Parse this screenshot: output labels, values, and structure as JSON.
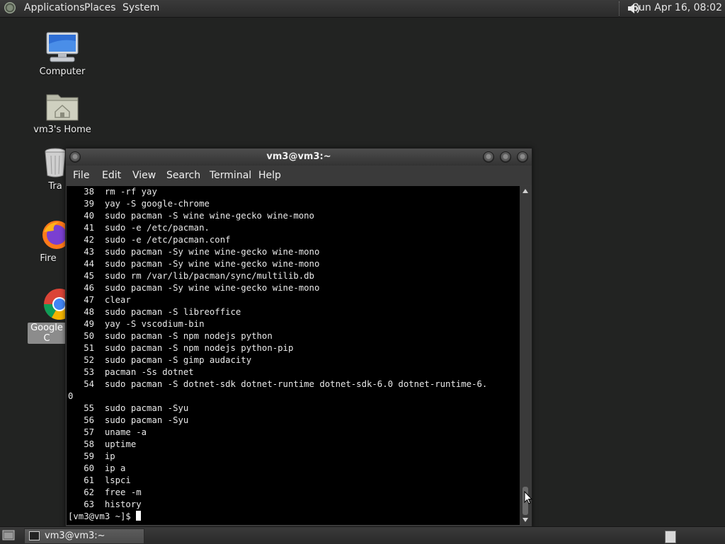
{
  "top_panel": {
    "menus": [
      "Applications",
      "Places",
      "System"
    ],
    "clock": "Sun Apr 16, 08:02",
    "icons": {
      "logo": "distro-logo-icon",
      "volume": "speaker-icon"
    }
  },
  "desktop": {
    "icons": [
      {
        "label": "Computer",
        "icon": "computer-icon"
      },
      {
        "label": "vm3's Home",
        "icon": "home-folder-icon"
      },
      {
        "label": "Tra",
        "icon": "trash-icon"
      },
      {
        "label": "Fire",
        "icon": "firefox-icon"
      },
      {
        "label": "Google C",
        "icon": "chrome-icon"
      }
    ]
  },
  "terminal": {
    "title": "vm3@vm3:~",
    "menu": [
      "File",
      "Edit",
      "View",
      "Search",
      "Terminal",
      "Help"
    ],
    "lines": [
      "   38  rm -rf yay",
      "   39  yay -S google-chrome",
      "   40  sudo pacman -S wine wine-gecko wine-mono",
      "   41  sudo -e /etc/pacman.",
      "   42  sudo -e /etc/pacman.conf",
      "   43  sudo pacman -Sy wine wine-gecko wine-mono",
      "   44  sudo pacman -Sy wine wine-gecko wine-mono",
      "   45  sudo rm /var/lib/pacman/sync/multilib.db",
      "   46  sudo pacman -Sy wine wine-gecko wine-mono",
      "   47  clear",
      "   48  sudo pacman -S libreoffice",
      "   49  yay -S vscodium-bin",
      "   50  sudo pacman -S npm nodejs python",
      "   51  sudo pacman -S npm nodejs python-pip",
      "   52  sudo pacman -S gimp audacity",
      "   53  pacman -Ss dotnet",
      "   54  sudo pacman -S dotnet-sdk dotnet-runtime dotnet-sdk-6.0 dotnet-runtime-6.",
      "0",
      "   55  sudo pacman -Syu",
      "   56  sudo pacman -Syu",
      "   57  uname -a",
      "   58  uptime",
      "   59  ip",
      "   60  ip a",
      "   61  lspci",
      "   62  free -m",
      "   63  history"
    ],
    "prompt": "[vm3@vm3 ~]$ ",
    "scroll_position": 1.0
  },
  "bottom_panel": {
    "taskbar_item": "vm3@vm3:~",
    "icons": {
      "show_desktop": "show-desktop-icon",
      "task": "terminal-icon",
      "workspace": "workspace-switcher-icon"
    }
  }
}
